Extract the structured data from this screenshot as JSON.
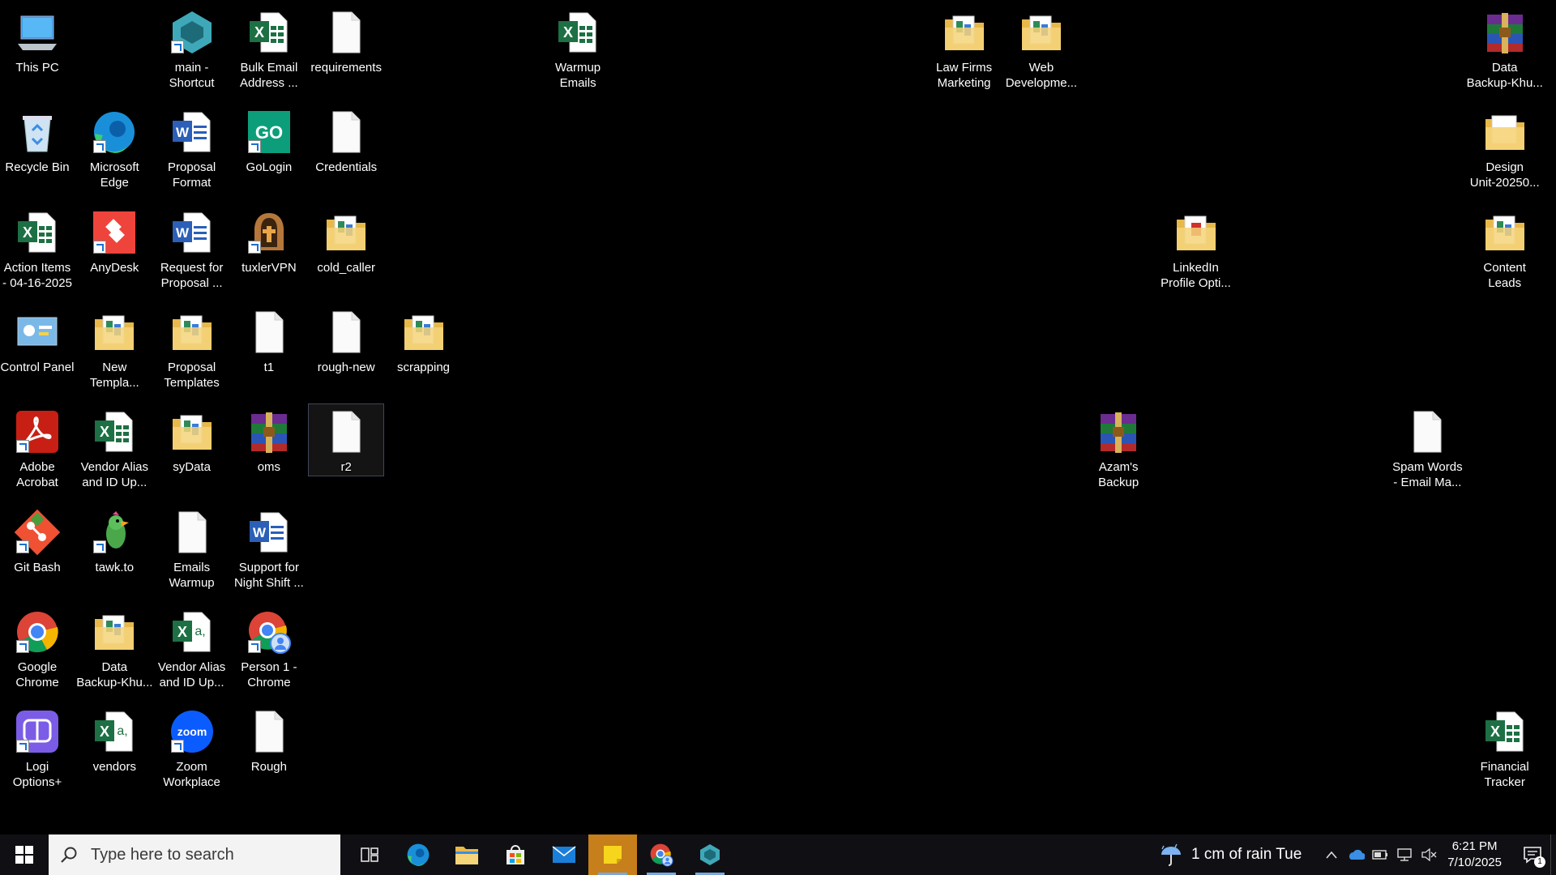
{
  "desktop": {
    "icons": [
      {
        "name": "this-pc",
        "label": "This PC",
        "type": "pc",
        "col": 0,
        "row": 0
      },
      {
        "name": "recycle-bin",
        "label": "Recycle Bin",
        "type": "recycle",
        "col": 0,
        "row": 1
      },
      {
        "name": "action-items",
        "label": "Action Items\n- 04-16-2025",
        "type": "excel",
        "col": 0,
        "row": 2
      },
      {
        "name": "control-panel",
        "label": "Control Panel",
        "type": "control",
        "col": 0,
        "row": 3
      },
      {
        "name": "adobe-acrobat",
        "label": "Adobe\nAcrobat",
        "type": "acrobat",
        "col": 0,
        "row": 4,
        "shortcut": true
      },
      {
        "name": "git-bash",
        "label": "Git Bash",
        "type": "git",
        "col": 0,
        "row": 5,
        "shortcut": true
      },
      {
        "name": "google-chrome",
        "label": "Google\nChrome",
        "type": "chrome",
        "col": 0,
        "row": 6,
        "shortcut": true
      },
      {
        "name": "logi-options",
        "label": "Logi\nOptions+",
        "type": "logi",
        "col": 0,
        "row": 7,
        "shortcut": true
      },
      {
        "name": "microsoft-edge",
        "label": "Microsoft\nEdge",
        "type": "edge",
        "col": 1,
        "row": 1,
        "shortcut": true
      },
      {
        "name": "anydesk",
        "label": "AnyDesk",
        "type": "anydesk",
        "col": 1,
        "row": 2,
        "shortcut": true
      },
      {
        "name": "new-templa",
        "label": "New\nTempla...",
        "type": "folder",
        "col": 1,
        "row": 3
      },
      {
        "name": "vendor-alias-1",
        "label": "Vendor Alias\nand ID Up...",
        "type": "excel",
        "col": 1,
        "row": 4
      },
      {
        "name": "tawk-to",
        "label": "tawk.to",
        "type": "tawk",
        "col": 1,
        "row": 5,
        "shortcut": true
      },
      {
        "name": "data-backup-khu-1",
        "label": "Data\nBackup-Khu...",
        "type": "folder",
        "col": 1,
        "row": 6
      },
      {
        "name": "vendors",
        "label": "vendors",
        "type": "excelcsv",
        "col": 1,
        "row": 7
      },
      {
        "name": "main-shortcut",
        "label": "main -\nShortcut",
        "type": "kiro",
        "col": 2,
        "row": 0,
        "shortcut": true
      },
      {
        "name": "proposal-format",
        "label": "Proposal\nFormat",
        "type": "word",
        "col": 2,
        "row": 1
      },
      {
        "name": "request-for-proposal",
        "label": "Request for\nProposal ...",
        "type": "word",
        "col": 2,
        "row": 2
      },
      {
        "name": "proposal-templates",
        "label": "Proposal\nTemplates",
        "type": "folder",
        "col": 2,
        "row": 3
      },
      {
        "name": "sydata",
        "label": "syData",
        "type": "folder",
        "col": 2,
        "row": 4
      },
      {
        "name": "emails-warmup",
        "label": "Emails\nWarmup",
        "type": "file",
        "col": 2,
        "row": 5
      },
      {
        "name": "vendor-alias-2",
        "label": "Vendor Alias\nand ID Up...",
        "type": "excelcsv",
        "col": 2,
        "row": 6
      },
      {
        "name": "zoom-workplace",
        "label": "Zoom\nWorkplace",
        "type": "zoom",
        "col": 2,
        "row": 7,
        "shortcut": true
      },
      {
        "name": "bulk-email",
        "label": "Bulk Email\nAddress ...",
        "type": "excel",
        "col": 3,
        "row": 0
      },
      {
        "name": "gologin",
        "label": "GoLogin",
        "type": "gologin",
        "col": 3,
        "row": 1,
        "shortcut": true
      },
      {
        "name": "tuxlervpn",
        "label": "tuxlerVPN",
        "type": "tuxler",
        "col": 3,
        "row": 2,
        "shortcut": true
      },
      {
        "name": "t1",
        "label": "t1",
        "type": "file",
        "col": 3,
        "row": 3
      },
      {
        "name": "oms",
        "label": "oms",
        "type": "rar",
        "col": 3,
        "row": 4
      },
      {
        "name": "support-night-shift",
        "label": "Support for\nNight Shift ...",
        "type": "word",
        "col": 3,
        "row": 5
      },
      {
        "name": "person1-chrome",
        "label": "Person 1 -\nChrome",
        "type": "chromep",
        "col": 3,
        "row": 6,
        "shortcut": true
      },
      {
        "name": "rough",
        "label": "Rough",
        "type": "file",
        "col": 3,
        "row": 7
      },
      {
        "name": "requirements",
        "label": "requirements",
        "type": "file",
        "col": 4,
        "row": 0
      },
      {
        "name": "credentials",
        "label": "Credentials",
        "type": "file",
        "col": 4,
        "row": 1
      },
      {
        "name": "cold-caller",
        "label": "cold_caller",
        "type": "folder",
        "col": 4,
        "row": 2
      },
      {
        "name": "rough-new",
        "label": "rough-new",
        "type": "file",
        "col": 4,
        "row": 3
      },
      {
        "name": "r2",
        "label": "r2",
        "type": "file",
        "col": 4,
        "row": 4,
        "selected": true
      },
      {
        "name": "scrapping",
        "label": "scrapping",
        "type": "folder",
        "col": 5,
        "row": 3
      },
      {
        "name": "warmup-emails",
        "label": "Warmup\nEmails",
        "type": "excel",
        "col": 7,
        "row": 0
      },
      {
        "name": "law-firms-marketing",
        "label": "Law Firms\nMarketing",
        "type": "folder",
        "col": 12,
        "row": 0
      },
      {
        "name": "web-development",
        "label": "Web\nDevelopme...",
        "type": "folder",
        "col": 13,
        "row": 0
      },
      {
        "name": "azams-backup",
        "label": "Azam's\nBackup",
        "type": "rar",
        "col": 14,
        "row": 4
      },
      {
        "name": "linkedin-profile",
        "label": "LinkedIn\nProfile Opti...",
        "type": "folderpdf",
        "col": 15,
        "row": 2
      },
      {
        "name": "spam-words",
        "label": "Spam Words\n- Email Ma...",
        "type": "file",
        "col": 18,
        "row": 4
      },
      {
        "name": "data-backup-khu-2",
        "label": "Data\nBackup-Khu...",
        "type": "rar",
        "col": 19,
        "row": 0
      },
      {
        "name": "design-unit",
        "label": "Design\nUnit-20250...",
        "type": "folderplain",
        "col": 19,
        "row": 1
      },
      {
        "name": "content-leads",
        "label": "Content\nLeads",
        "type": "folder",
        "col": 19,
        "row": 2
      },
      {
        "name": "financial-tracker",
        "label": "Financial\nTracker",
        "type": "excel",
        "col": 19,
        "row": 7
      }
    ]
  },
  "taskbar": {
    "search_placeholder": "Type here to search",
    "pinned": [
      {
        "name": "task-view",
        "icon": "task-view-icon"
      },
      {
        "name": "edge",
        "icon": "edge-icon"
      },
      {
        "name": "file-explorer",
        "icon": "folder-icon"
      },
      {
        "name": "store",
        "icon": "store-icon"
      },
      {
        "name": "mail",
        "icon": "mail-icon"
      },
      {
        "name": "sticky-notes",
        "icon": "sticky-notes-icon",
        "active": true
      },
      {
        "name": "chrome",
        "icon": "chrome-icon",
        "open": true
      },
      {
        "name": "kiro",
        "icon": "kiro-icon",
        "open": true
      }
    ],
    "weather": "1 cm of rain Tue",
    "clock": {
      "time": "6:21 PM",
      "date": "7/10/2025"
    },
    "notification_count": "1"
  }
}
